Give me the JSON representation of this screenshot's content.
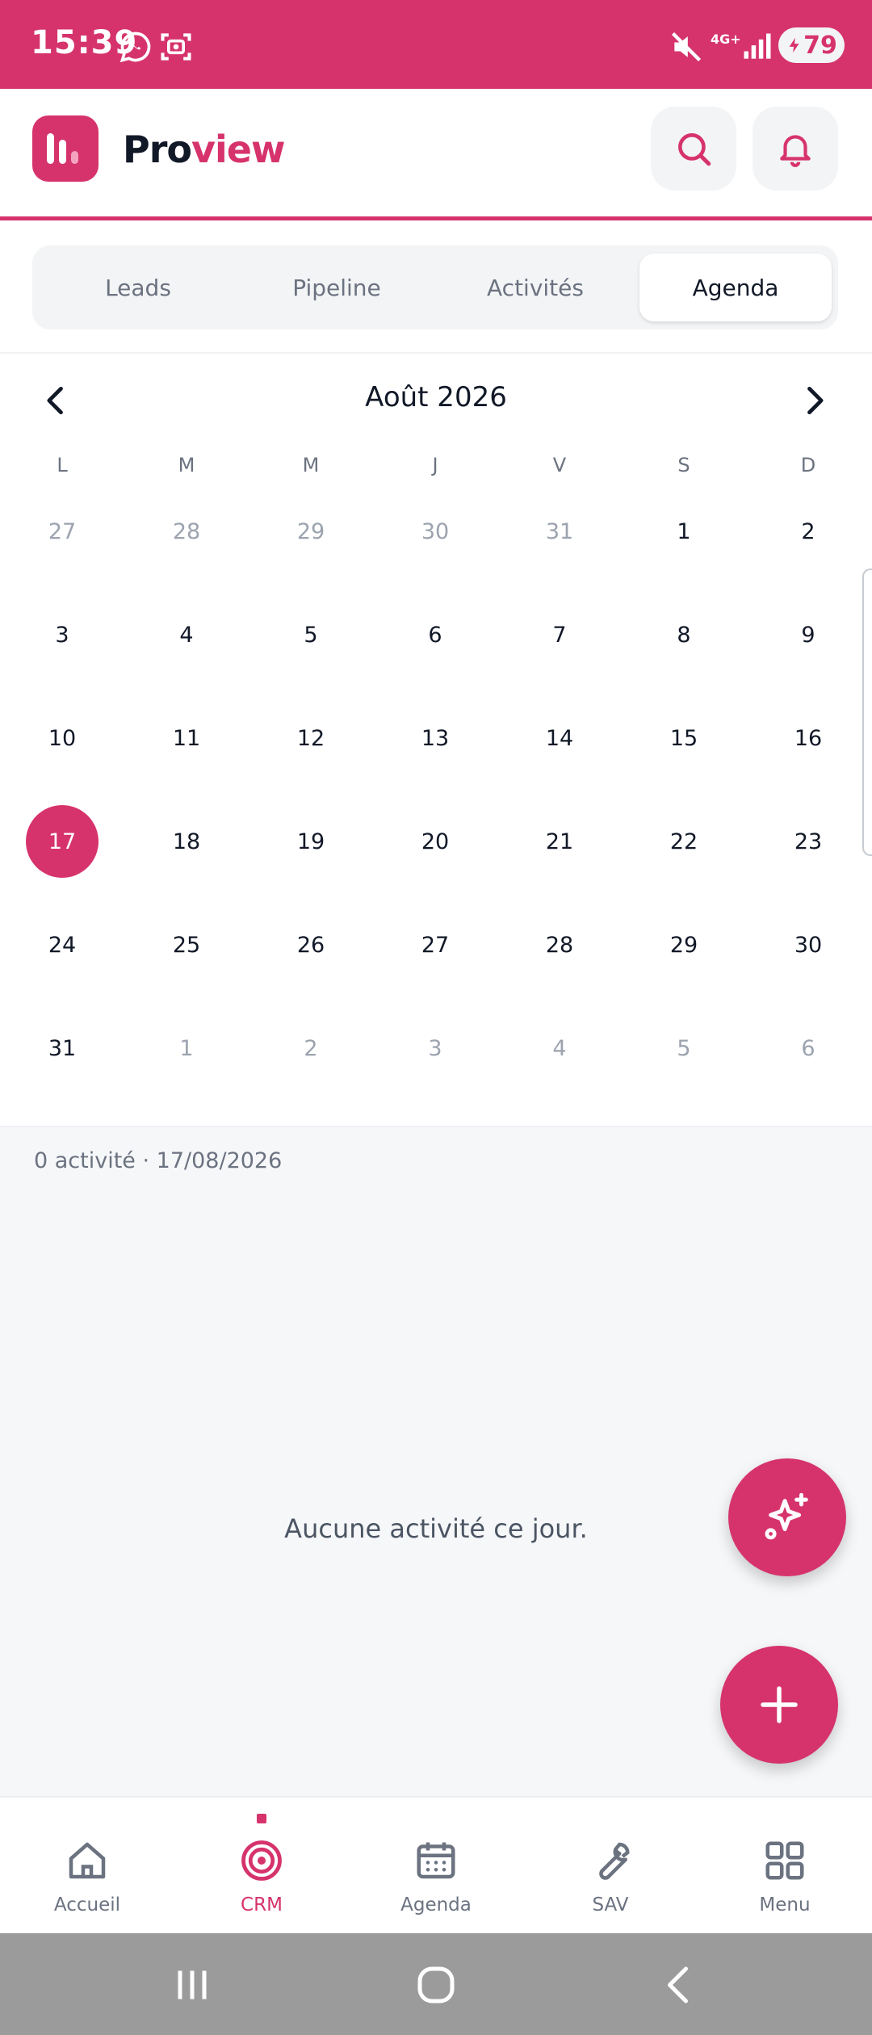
{
  "status_bar": {
    "time": "15:39",
    "battery": "79",
    "network": "4G+"
  },
  "header": {
    "brand_prefix": "Pro",
    "brand_suffix": "view"
  },
  "tabs": [
    {
      "label": "Leads",
      "active": false
    },
    {
      "label": "Pipeline",
      "active": false
    },
    {
      "label": "Activités",
      "active": false
    },
    {
      "label": "Agenda",
      "active": true
    }
  ],
  "calendar": {
    "month_label": "Août 2026",
    "weekdays": [
      "L",
      "M",
      "M",
      "J",
      "V",
      "S",
      "D"
    ],
    "selected_day": "17",
    "weeks": [
      [
        {
          "d": "27",
          "m": true
        },
        {
          "d": "28",
          "m": true
        },
        {
          "d": "29",
          "m": true
        },
        {
          "d": "30",
          "m": true
        },
        {
          "d": "31",
          "m": true
        },
        {
          "d": "1",
          "m": false
        },
        {
          "d": "2",
          "m": false
        }
      ],
      [
        {
          "d": "3",
          "m": false
        },
        {
          "d": "4",
          "m": false
        },
        {
          "d": "5",
          "m": false
        },
        {
          "d": "6",
          "m": false
        },
        {
          "d": "7",
          "m": false
        },
        {
          "d": "8",
          "m": false
        },
        {
          "d": "9",
          "m": false
        }
      ],
      [
        {
          "d": "10",
          "m": false
        },
        {
          "d": "11",
          "m": false
        },
        {
          "d": "12",
          "m": false
        },
        {
          "d": "13",
          "m": false
        },
        {
          "d": "14",
          "m": false
        },
        {
          "d": "15",
          "m": false
        },
        {
          "d": "16",
          "m": false
        }
      ],
      [
        {
          "d": "17",
          "m": false,
          "sel": true
        },
        {
          "d": "18",
          "m": false
        },
        {
          "d": "19",
          "m": false
        },
        {
          "d": "20",
          "m": false
        },
        {
          "d": "21",
          "m": false
        },
        {
          "d": "22",
          "m": false
        },
        {
          "d": "23",
          "m": false
        }
      ],
      [
        {
          "d": "24",
          "m": false
        },
        {
          "d": "25",
          "m": false
        },
        {
          "d": "26",
          "m": false
        },
        {
          "d": "27",
          "m": false
        },
        {
          "d": "28",
          "m": false
        },
        {
          "d": "29",
          "m": false
        },
        {
          "d": "30",
          "m": false
        }
      ],
      [
        {
          "d": "31",
          "m": false
        },
        {
          "d": "1",
          "m": true
        },
        {
          "d": "2",
          "m": true
        },
        {
          "d": "3",
          "m": true
        },
        {
          "d": "4",
          "m": true
        },
        {
          "d": "5",
          "m": true
        },
        {
          "d": "6",
          "m": true
        }
      ]
    ]
  },
  "activities": {
    "count_label": "0 activité · 17/08/2026",
    "empty_message": "Aucune activité ce jour."
  },
  "bottom_nav": [
    {
      "label": "Accueil",
      "icon": "home-icon",
      "active": false
    },
    {
      "label": "CRM",
      "icon": "target-icon",
      "active": true
    },
    {
      "label": "Agenda",
      "icon": "calendar-icon",
      "active": false
    },
    {
      "label": "SAV",
      "icon": "wrench-icon",
      "active": false
    },
    {
      "label": "Menu",
      "icon": "grid-icon",
      "active": false
    }
  ],
  "colors": {
    "accent": "#d6336c",
    "muted_text": "#6b7280",
    "surface": "#f3f4f6"
  }
}
